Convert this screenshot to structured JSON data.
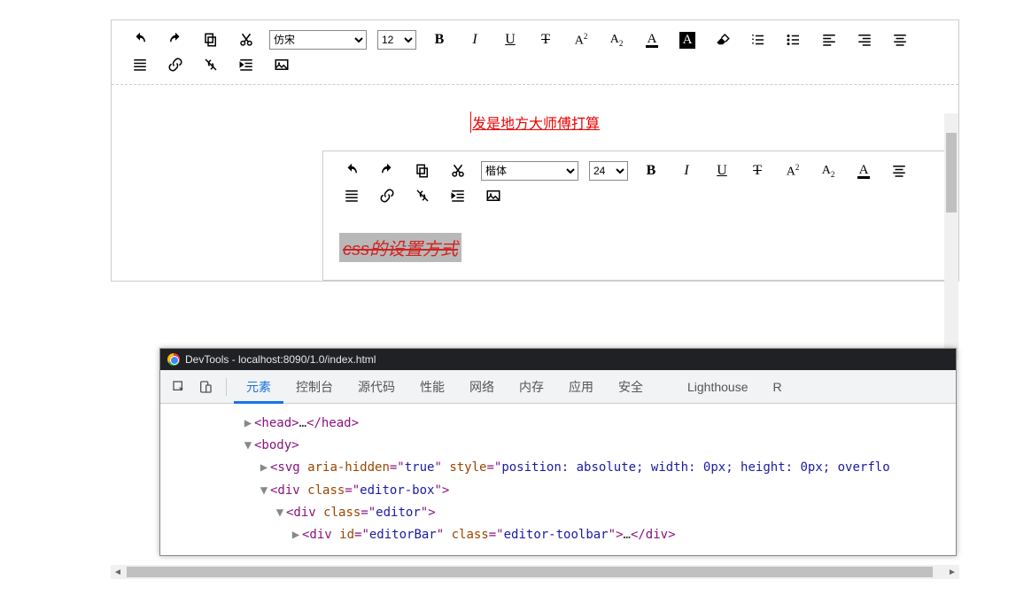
{
  "outer_editor": {
    "font_selected": "仿宋",
    "size_selected": "12",
    "content": "发是地方大师傅打算"
  },
  "inner_editor": {
    "font_selected": "楷体",
    "size_selected": "24",
    "content": "css的设置方式"
  },
  "toolbar_letters": {
    "bold": "B",
    "italic": "I",
    "underline": "U",
    "strike": "T",
    "sup": "A",
    "sup_mark": "2",
    "sub": "A",
    "sub_mark": "2",
    "fontcolor": "A",
    "bgcolor": "A"
  },
  "devtools": {
    "title": "DevTools - localhost:8090/1.0/index.html",
    "tabs": [
      "元素",
      "控制台",
      "源代码",
      "性能",
      "网络",
      "内存",
      "应用",
      "安全",
      "Lighthouse",
      "R"
    ],
    "active_tab": 0,
    "lines": {
      "head": "<head>…</head>",
      "body": "<body>",
      "svg_open": "<svg ",
      "svg_attr1_n": "aria-hidden",
      "svg_attr1_v": "true",
      "svg_attr2_n": "style",
      "svg_attr2_v": "position: absolute; width: 0px; height: 0px; overflo",
      "div1_open": "<div ",
      "div1_attr_n": "class",
      "div1_attr_v": "editor-box",
      "div2_open": "<div ",
      "div2_attr_n": "class",
      "div2_attr_v": "editor",
      "div3_open": "<div ",
      "div3_attr1_n": "id",
      "div3_attr1_v": "editorBar",
      "div3_attr2_n": "class",
      "div3_attr2_v": "editor-toolbar",
      "div3_close": ">…</div>",
      "close_angle": ">"
    }
  }
}
